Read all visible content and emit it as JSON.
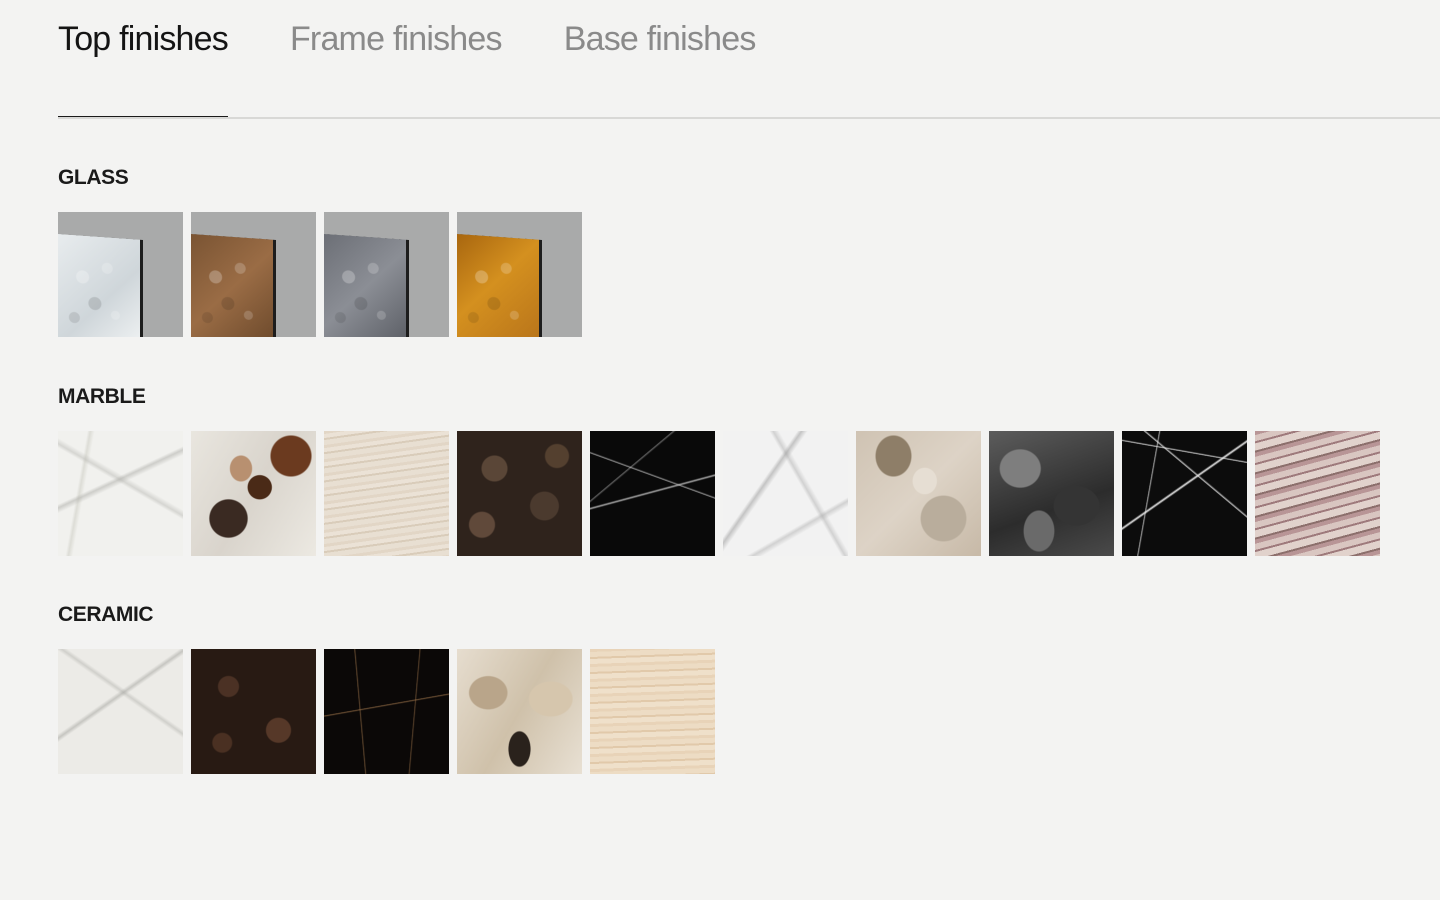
{
  "tabs": [
    {
      "label": "Top finishes",
      "active": true
    },
    {
      "label": "Frame finishes",
      "active": false
    },
    {
      "label": "Base finishes",
      "active": false
    }
  ],
  "sections": {
    "glass": {
      "title": "GLASS",
      "swatch_count": 4
    },
    "marble": {
      "title": "MARBLE",
      "swatch_count": 10
    },
    "ceramic": {
      "title": "CERAMIC",
      "swatch_count": 5
    }
  },
  "colors": {
    "background": "#f3f3f2",
    "active_tab_text": "#141414",
    "inactive_tab_text": "#8a8a8a",
    "active_underline": "#1a1a1a"
  }
}
